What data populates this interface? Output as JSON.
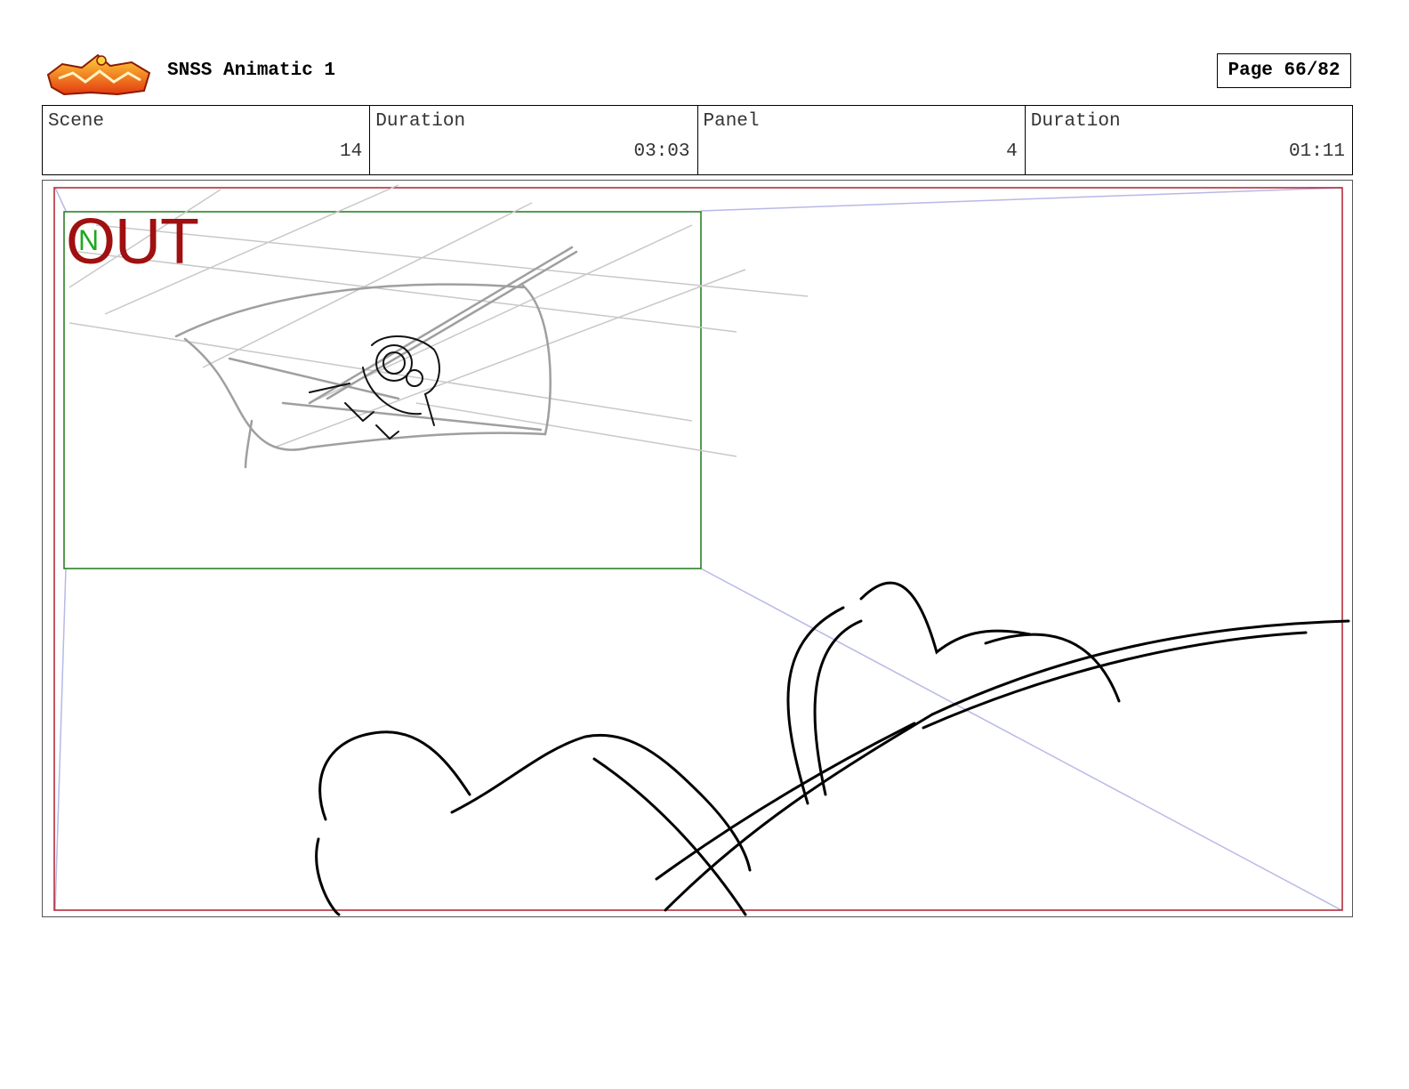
{
  "header": {
    "title": "SNSS Animatic 1",
    "page": "Page 66/82"
  },
  "info": {
    "scene_label": "Scene",
    "scene_value": "14",
    "scene_duration_label": "Duration",
    "scene_duration_value": "03:03",
    "panel_label": "Panel",
    "panel_value": "4",
    "panel_duration_label": "Duration",
    "panel_duration_value": "01:11"
  },
  "panel": {
    "camera_move_label": "OUT",
    "camera_in_letter": "N"
  },
  "colors": {
    "frame_red": "#b01f2e",
    "inner_green": "#1b7a1b",
    "out_red": "#a01010",
    "in_green": "#1fa81f",
    "guide_lavender": "#b8b8e8"
  }
}
